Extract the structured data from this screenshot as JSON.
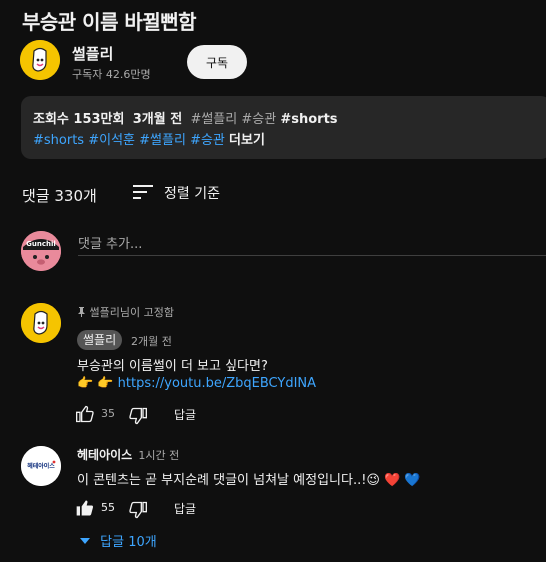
{
  "video": {
    "title": "부승관 이름 바뀔뻔함"
  },
  "channel": {
    "name": "썰플리",
    "subscribers": "구독자 42.6만명",
    "subscribe_label": "구독"
  },
  "description": {
    "views": "조회수 153만회",
    "age": "3개월 전",
    "tags_line1": [
      "#썰플리",
      "#승관",
      "#shorts"
    ],
    "tags_line2": [
      "#shorts",
      "#이석훈",
      "#썰플리",
      "#승관"
    ],
    "more_label": "더보기"
  },
  "comments_header": {
    "count_label": "댓글 330개",
    "sort_label": "정렬 기준"
  },
  "add_comment": {
    "placeholder": "댓글 추가...",
    "avatar_text": "Gunchil"
  },
  "comments": [
    {
      "pinned_label": "썰플리님이 고정함",
      "author": "썰플리",
      "time": "2개월 전",
      "text": "부승관의 이름썰이 더 보고 싶다면?",
      "emoji": "👉 👉",
      "link": "https://youtu.be/ZbqEBCYdINA",
      "likes": "35",
      "reply_label": "답글"
    },
    {
      "author": "헤테아이스",
      "avatar_text": "헤테아이스",
      "time": "1시간 전",
      "text": "이 콘텐츠는 곧 부지순례 댓글이 넘쳐날 예정입니다..!😉 ❤️ 💙",
      "likes": "55",
      "reply_label": "답글",
      "replies_label": "답글 10개"
    }
  ],
  "icons": {
    "sort": "sort-icon",
    "like": "thumbs-up-icon",
    "dislike": "thumbs-down-icon",
    "pin": "pin-icon",
    "expand": "caret-down-icon"
  },
  "colors": {
    "background": "#0f0f0f",
    "link": "#3ea6ff",
    "channel_avatar": "#f5c400"
  }
}
